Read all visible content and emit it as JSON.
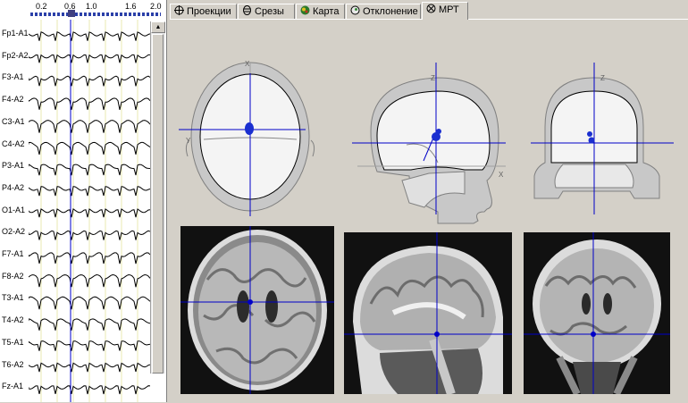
{
  "eeg": {
    "time_ticks": [
      "0.2",
      "0.6",
      "1.0",
      "1.6",
      "2.0"
    ],
    "channels": [
      "Fp1-A1",
      "Fp2-A2",
      "F3-A1",
      "F4-A2",
      "C3-A1",
      "C4-A2",
      "P3-A1",
      "P4-A2",
      "O1-A1",
      "O2-A2",
      "F7-A1",
      "F8-A2",
      "T3-A1",
      "T4-A2",
      "T5-A1",
      "T6-A2",
      "Fz-A1"
    ]
  },
  "tabs": [
    {
      "label": "Проекции",
      "icon": "projections-icon"
    },
    {
      "label": "Срезы",
      "icon": "slices-icon"
    },
    {
      "label": "Карта",
      "icon": "map-icon"
    },
    {
      "label": "Отклонение",
      "icon": "deviation-icon"
    },
    {
      "label": "МРТ",
      "icon": "mri-icon",
      "active": true
    }
  ],
  "colors": {
    "cursor": "#0000c8",
    "dipole": "#1a2fd0",
    "panel": "#d4d0c8"
  },
  "views": [
    "axial",
    "sagittal",
    "coronal"
  ],
  "axis_letters": {
    "x": "X",
    "y": "Y",
    "z": "Z"
  }
}
